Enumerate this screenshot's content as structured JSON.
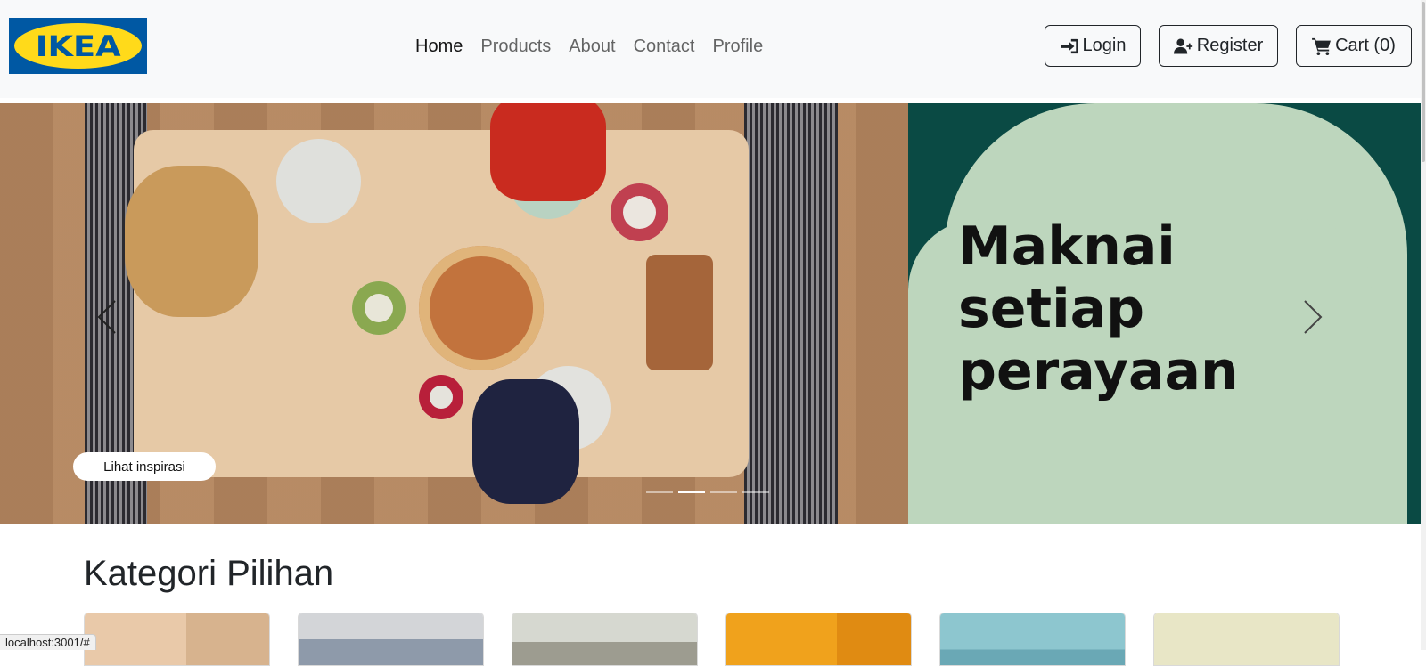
{
  "brand": {
    "logo_text": "IKEA",
    "logo_mark": "®",
    "colors": {
      "blue": "#0058a3",
      "yellow": "#ffda1a"
    }
  },
  "nav": {
    "links": [
      {
        "label": "Home",
        "active": true
      },
      {
        "label": "Products",
        "active": false
      },
      {
        "label": "About",
        "active": false
      },
      {
        "label": "Contact",
        "active": false
      },
      {
        "label": "Profile",
        "active": false
      }
    ]
  },
  "actions": {
    "login": {
      "label": "Login",
      "icon": "sign-in-icon"
    },
    "register": {
      "label": "Register",
      "icon": "user-plus-icon"
    },
    "cart": {
      "label": "Cart (0)",
      "icon": "cart-icon"
    }
  },
  "carousel": {
    "promo_text": "Maknai\nsetiap\nperayaan",
    "cta_label": "Lihat inspirasi",
    "slide_count": 4,
    "active_slide": 1,
    "colors": {
      "panel_dark": "#0a4a44",
      "panel_light": "#bdd6bd"
    }
  },
  "categories": {
    "title": "Kategori Pilihan",
    "cards": [
      {
        "icon": "desk-image",
        "color": "#e9c9a9"
      },
      {
        "icon": "bed-image",
        "color": "#c9cdd3"
      },
      {
        "icon": "sofa-image",
        "color": "#d6d8d0"
      },
      {
        "icon": "storage-image",
        "color": "#f0a21c"
      },
      {
        "icon": "kids-image",
        "color": "#8dc6cf"
      },
      {
        "icon": "lighting-image",
        "color": "#e8e6c6"
      }
    ]
  },
  "status": {
    "url": "localhost:3001/#"
  }
}
